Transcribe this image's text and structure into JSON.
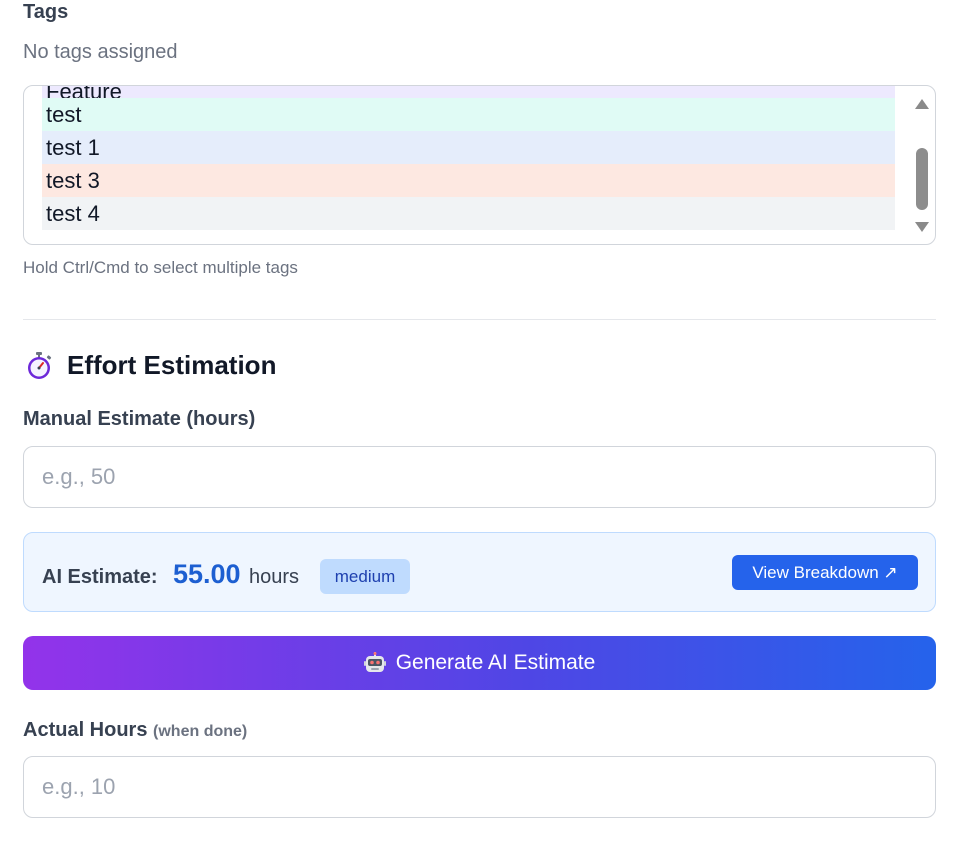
{
  "tags": {
    "label": "Tags",
    "empty_text": "No tags assigned",
    "options": [
      "Feature",
      "test",
      "test 1",
      "test 3",
      "test 4"
    ],
    "hint": "Hold Ctrl/Cmd to select multiple tags"
  },
  "effort": {
    "title": "Effort Estimation",
    "icon": "stopwatch-icon",
    "manual_label": "Manual Estimate (hours)",
    "manual_placeholder": "e.g., 50",
    "ai": {
      "label": "AI Estimate:",
      "value": "55.00",
      "unit": "hours",
      "confidence": "medium",
      "view_button": "View Breakdown ↗"
    },
    "generate_button": "Generate AI Estimate",
    "generate_icon": "robot-icon",
    "actual_label": "Actual Hours",
    "actual_sublabel": "(when done)",
    "actual_placeholder": "e.g., 10"
  },
  "colors": {
    "primary": "#2563eb",
    "gradient_start": "#9333ea",
    "gradient_end": "#2563eb",
    "ai_box_bg": "#eff6ff",
    "badge_bg": "#bfdbfe"
  }
}
